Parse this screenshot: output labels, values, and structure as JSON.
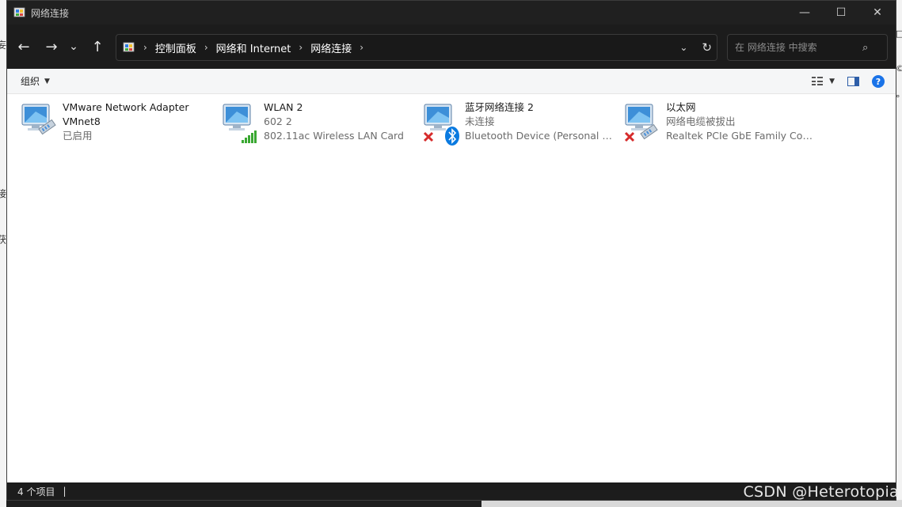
{
  "window": {
    "title": "网络连接",
    "controls": {
      "minimize": "—",
      "maximize": "☐",
      "close": "✕"
    }
  },
  "nav": {
    "back": "←",
    "forward": "→",
    "recent": "⌄",
    "up": "↑",
    "breadcrumbs": [
      "控制面板",
      "网络和 Internet",
      "网络连接"
    ],
    "search_placeholder": "在 网络连接 中搜索"
  },
  "toolbar": {
    "organize_label": "组织",
    "help_label": "?"
  },
  "connections": [
    {
      "name": "VMware Network Adapter",
      "line2": "VMnet8",
      "line3": "已启用",
      "type": "ethernet",
      "disconnected": false
    },
    {
      "name": "WLAN 2",
      "line2": "602 2",
      "line3": "802.11ac Wireless LAN Card",
      "type": "wifi",
      "disconnected": false
    },
    {
      "name": "蓝牙网络连接 2",
      "line2": "未连接",
      "line3": "Bluetooth Device (Personal Ar...",
      "type": "bluetooth",
      "disconnected": true
    },
    {
      "name": "以太网",
      "line2": "网络电缆被拔出",
      "line3": "Realtek PCIe GbE Family Contr...",
      "type": "ethernet",
      "disconnected": true
    }
  ],
  "status": {
    "count": "4 个项目",
    "separator": "|"
  },
  "watermark": "CSDN @Heterotopia",
  "colors": {
    "titlebar": "#202020",
    "navbar": "#1c1c1c",
    "accent": "#1a73e8",
    "error_red": "#d62b2b",
    "bluetooth_blue": "#0a7ae0",
    "wifi_green": "#3aa832"
  }
}
